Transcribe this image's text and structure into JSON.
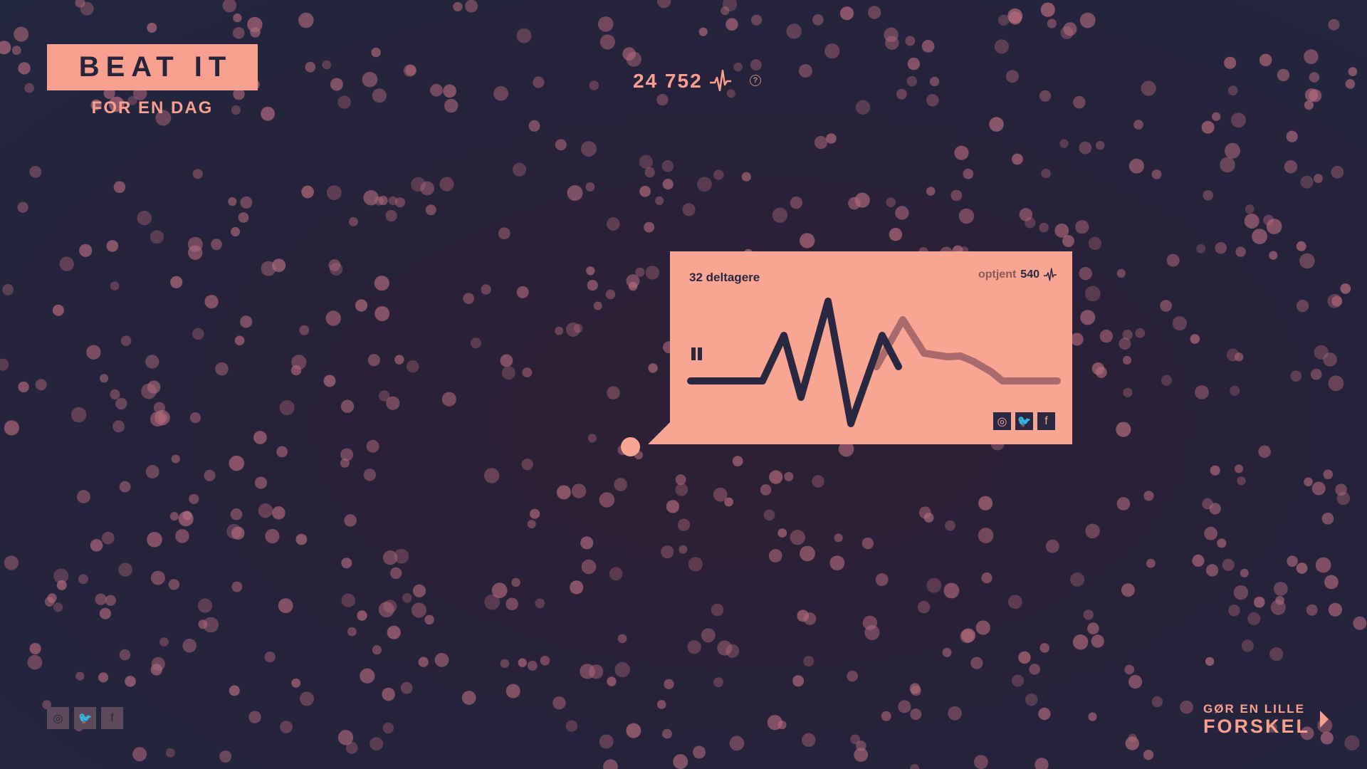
{
  "colors": {
    "accent": "#f7a08f",
    "card": "#f8a593",
    "dark": "#2a2840",
    "particle": "#b56c7e",
    "wave_faded": "#a96a6b"
  },
  "logo": {
    "title": "BEAT IT",
    "subtitle": "FOR EN DAG"
  },
  "header": {
    "total_beats": "24 752",
    "beat_icon": "heartbeat-icon",
    "help_icon": "question-icon",
    "help_symbol": "?"
  },
  "card": {
    "participants": "32 deltagere",
    "earned_label": "optjent",
    "earned_value": "540",
    "pause_icon": "pause-icon",
    "social": [
      {
        "name": "instagram-icon",
        "glyph": "◎"
      },
      {
        "name": "twitter-icon",
        "glyph": "🐦"
      },
      {
        "name": "facebook-icon",
        "glyph": "f"
      }
    ]
  },
  "footer": {
    "social": [
      {
        "name": "instagram-icon",
        "glyph": "◎"
      },
      {
        "name": "twitter-icon",
        "glyph": "🐦"
      },
      {
        "name": "facebook-icon",
        "glyph": "f"
      }
    ],
    "cta_line1": "GØR EN LILLE",
    "cta_line2": "FORSKEL",
    "cta_icon": "play-arrow-icon"
  }
}
